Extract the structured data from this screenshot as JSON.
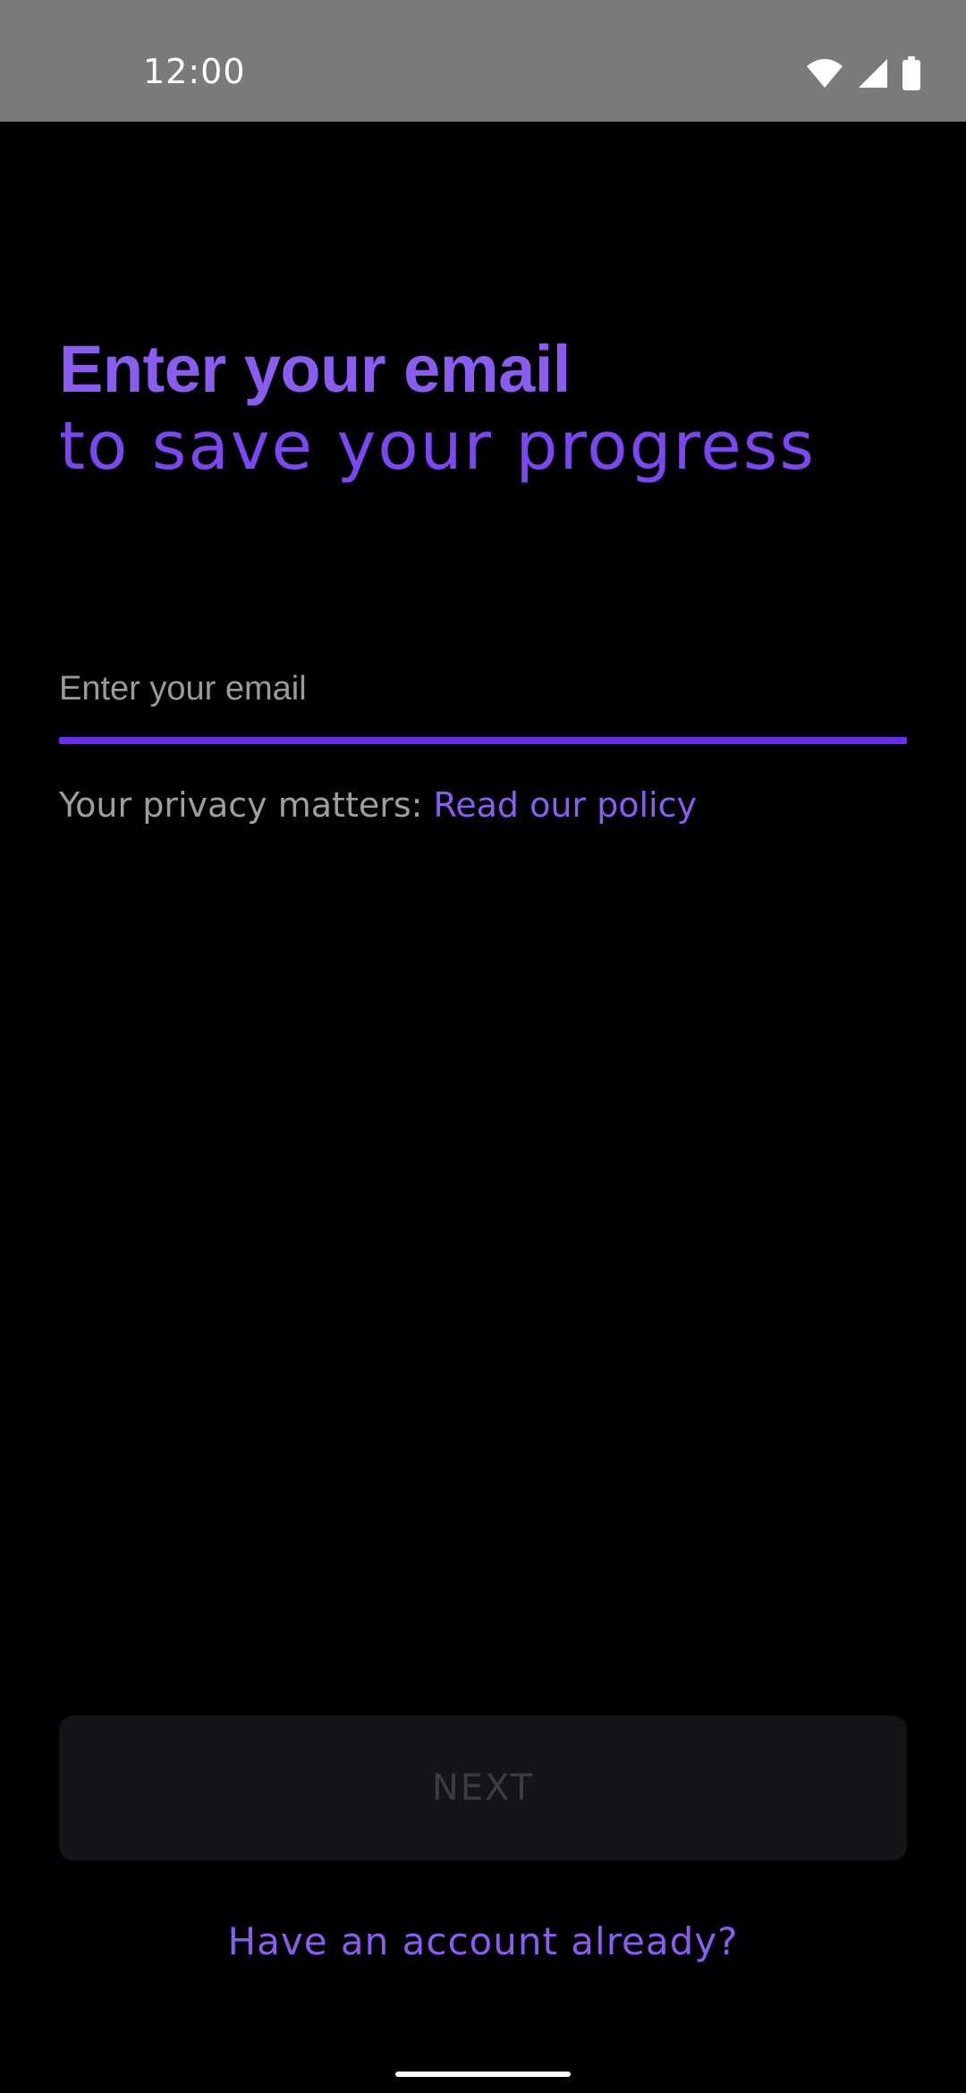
{
  "status_bar": {
    "time": "12:00",
    "icons": [
      "wifi-icon",
      "signal-icon",
      "battery-icon"
    ]
  },
  "heading": {
    "line1": "Enter your email",
    "line2": "to save your progress"
  },
  "email": {
    "placeholder": "Enter your email",
    "value": ""
  },
  "privacy": {
    "text": "Your privacy matters: ",
    "link_label": "Read our policy"
  },
  "next_button": {
    "label": "NEXT"
  },
  "account_link": {
    "label": "Have an account already?"
  },
  "colors": {
    "accent": "#8a5cf0",
    "underline": "#6a2cf2",
    "button_bg": "#151418",
    "button_text_disabled": "#3c3b40"
  }
}
